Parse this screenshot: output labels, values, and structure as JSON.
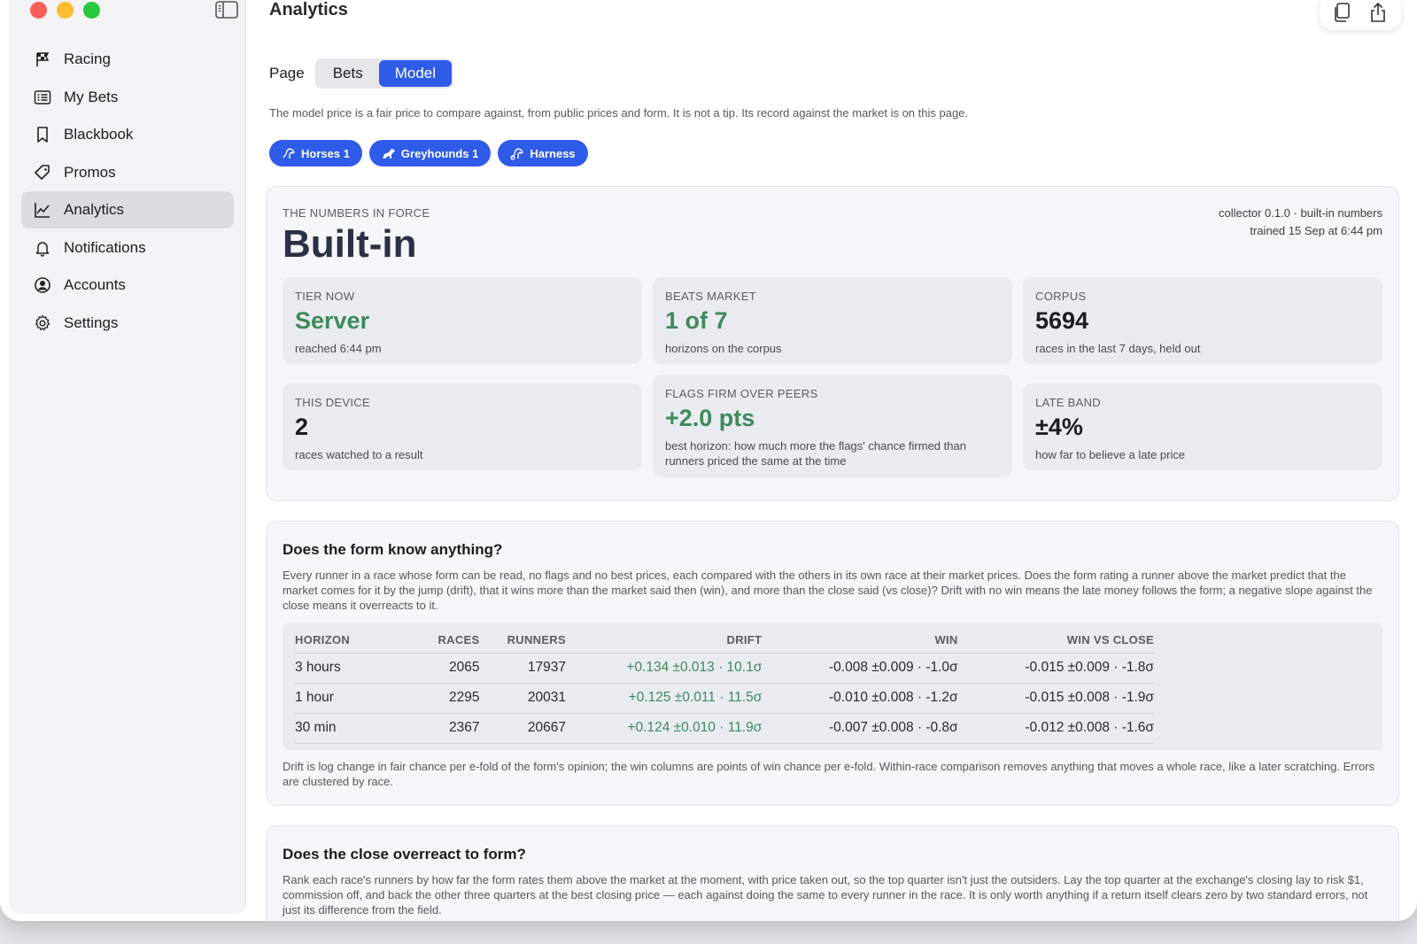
{
  "window": {
    "title": "Analytics"
  },
  "sidebar": {
    "items": [
      {
        "label": "Racing",
        "icon": "flag-icon",
        "active": false
      },
      {
        "label": "My Bets",
        "icon": "list-icon",
        "active": false
      },
      {
        "label": "Blackbook",
        "icon": "bookmark-icon",
        "active": false
      },
      {
        "label": "Promos",
        "icon": "tag-icon",
        "active": false
      },
      {
        "label": "Analytics",
        "icon": "chart-icon",
        "active": true
      },
      {
        "label": "Notifications",
        "icon": "bell-icon",
        "active": false
      },
      {
        "label": "Accounts",
        "icon": "person-icon",
        "active": false
      },
      {
        "label": "Settings",
        "icon": "gear-icon",
        "active": false
      }
    ]
  },
  "page_selector": {
    "label": "Page",
    "options": [
      "Bets",
      "Model"
    ],
    "selected": "Model"
  },
  "intro": "The model price is a fair price to compare against, from public prices and form. It is not a tip. Its record against the market is on this page.",
  "chips": [
    {
      "label": "Horses 1",
      "icon": "horse-icon"
    },
    {
      "label": "Greyhounds 1",
      "icon": "dog-icon"
    },
    {
      "label": "Harness",
      "icon": "harness-icon"
    }
  ],
  "force": {
    "eyebrow": "THE NUMBERS IN FORCE",
    "title": "Built-in",
    "meta_line1": "collector 0.1.0 · built-in numbers",
    "meta_line2": "trained 15 Sep at 6:44 pm",
    "tiles": [
      {
        "label": "TIER NOW",
        "value": "Server",
        "sub": "reached 6:44 pm",
        "green": true
      },
      {
        "label": "BEATS MARKET",
        "value": "1 of 7",
        "sub": "horizons on the corpus",
        "green": true
      },
      {
        "label": "CORPUS",
        "value": "5694",
        "sub": "races in the last 7 days, held out",
        "green": false
      },
      {
        "label": "THIS DEVICE",
        "value": "2",
        "sub": "races watched to a result",
        "green": false
      },
      {
        "label": "FLAGS FIRM OVER PEERS",
        "value": "+2.0 pts",
        "sub": "best horizon: how much more the flags' chance firmed than runners priced the same at the time",
        "green": true
      },
      {
        "label": "LATE BAND",
        "value": "±4%",
        "sub": "how far to believe a late price",
        "green": false
      }
    ]
  },
  "form_section": {
    "title": "Does the form know anything?",
    "body": "Every runner in a race whose form can be read, no flags and no best prices, each compared with the others in its own race at their market prices. Does the form rating a runner above the market predict that the market comes for it by the jump (drift), that it wins more than the market said then (win), and more than the close said (vs close)? Drift with no win means the late money follows the form; a negative slope against the close means it overreacts to it.",
    "columns": [
      "HORIZON",
      "RACES",
      "RUNNERS",
      "DRIFT",
      "WIN",
      "WIN VS CLOSE"
    ],
    "rows": [
      {
        "horizon": "3 hours",
        "races": "2065",
        "runners": "17937",
        "drift": "+0.134 ±0.013 · 10.1σ",
        "win": "-0.008 ±0.009 · -1.0σ",
        "win_vs_close": "-0.015 ±0.009 · -1.8σ"
      },
      {
        "horizon": "1 hour",
        "races": "2295",
        "runners": "20031",
        "drift": "+0.125 ±0.011 · 11.5σ",
        "win": "-0.010 ±0.008 · -1.2σ",
        "win_vs_close": "-0.015 ±0.008 · -1.9σ"
      },
      {
        "horizon": "30 min",
        "races": "2367",
        "runners": "20667",
        "drift": "+0.124 ±0.010 · 11.9σ",
        "win": "-0.007 ±0.008 · -0.8σ",
        "win_vs_close": "-0.012 ±0.008 · -1.6σ"
      }
    ],
    "footnote": "Drift is log change in fair chance per e-fold of the form's opinion; the win columns are points of win chance per e-fold. Within-race comparison removes anything that moves a whole race, like a later scratching. Errors are clustered by race."
  },
  "close_section": {
    "title": "Does the close overreact to form?",
    "body": "Rank each race's runners by how far the form rates them above the market at the moment, with price taken out, so the top quarter isn't just the outsiders. Lay the top quarter at the exchange's closing lay to risk $1, commission off, and back the other three quarters at the best closing price — each against doing the same to every runner in the race. It is only worth anything if a return itself clears zero by two standard errors, not just its difference from the field."
  },
  "colors": {
    "accent": "#2f5be9",
    "positive": "#3d8a5a"
  }
}
